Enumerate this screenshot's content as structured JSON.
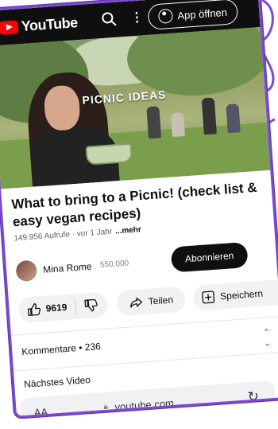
{
  "header": {
    "brand": "YouTube",
    "app_open_label": "App öffnen"
  },
  "video": {
    "overlay_text": "PICNIC IDEAS"
  },
  "details": {
    "title": "What to bring to a Picnic! (check list & easy vegan recipes)",
    "views_date": "149.956 Aufrufe · vor 1 Jahr",
    "more_label": "...mehr"
  },
  "channel": {
    "name": "Mina Rome",
    "subscribers": "550.000",
    "subscribe_label": "Abonnieren"
  },
  "actions": {
    "like_count": "9619",
    "share_label": "Teilen",
    "save_label": "Speichern"
  },
  "comments": {
    "label": "Kommentare • 236"
  },
  "next_video_label": "Nächstes Video",
  "browser": {
    "aa_label": "AA",
    "url": "youtube.com"
  },
  "colors": {
    "brand_red": "#ff0000",
    "frame_purple": "#7a4ad0",
    "dark": "#0f0f0f"
  }
}
